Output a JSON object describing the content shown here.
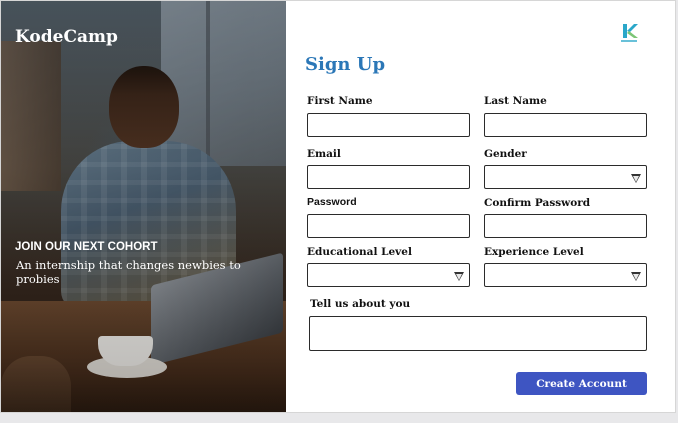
{
  "hero": {
    "brand": "KodeCamp",
    "cohort_heading": "JOIN OUR NEXT COHORT",
    "tagline": "An internship that changes newbies to probies"
  },
  "logo": {
    "icon": "kodecamp-logo-icon",
    "accent_color": "#2aa7c9",
    "secondary_color": "#7cc576"
  },
  "form": {
    "title": "Sign Up",
    "first_name": {
      "label": "First Name",
      "value": ""
    },
    "last_name": {
      "label": "Last Name",
      "value": ""
    },
    "email": {
      "label": "Email",
      "value": ""
    },
    "gender": {
      "label": "Gender",
      "selected": ""
    },
    "password": {
      "label": "Password",
      "value": ""
    },
    "confirm_password": {
      "label": "Confirm Password",
      "value": ""
    },
    "education_level": {
      "label": "Educational Level",
      "selected": ""
    },
    "experience_level": {
      "label": "Experience Level",
      "selected": ""
    },
    "about": {
      "label": "Tell us about you",
      "value": ""
    },
    "submit_label": "Create Account"
  },
  "colors": {
    "title": "#2b77b7",
    "button": "#3e55c2",
    "border": "#2b2b2b"
  }
}
